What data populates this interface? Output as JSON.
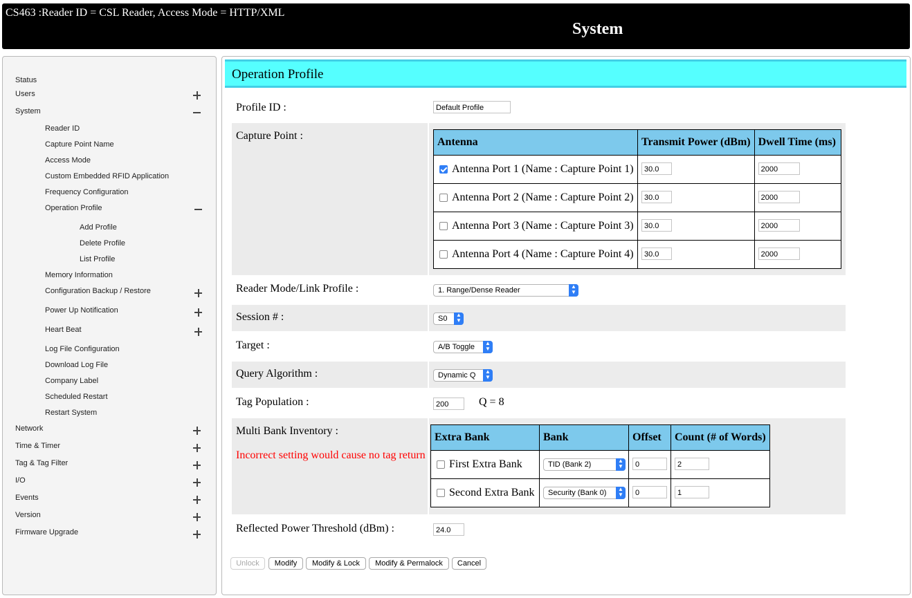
{
  "banner": {
    "reader_info": "CS463 :Reader ID = CSL Reader, Access Mode = HTTP/XML",
    "section_title": "System"
  },
  "sidebar": {
    "status": "Status",
    "users": "Users",
    "system": "System",
    "reader_id": "Reader ID",
    "capture_point_name": "Capture Point Name",
    "access_mode": "Access Mode",
    "custom_app": "Custom Embedded RFID Application",
    "frequency_config": "Frequency Configuration",
    "operation_profile": "Operation Profile",
    "add_profile": "Add Profile",
    "delete_profile": "Delete Profile",
    "list_profile": "List Profile",
    "memory_info": "Memory Information",
    "config_backup": "Configuration Backup / Restore",
    "power_up": "Power Up Notification",
    "heart_beat": "Heart Beat",
    "log_file_config": "Log File Configuration",
    "download_log": "Download Log File",
    "company_label": "Company Label",
    "scheduled_restart": "Scheduled Restart",
    "restart_system": "Restart System",
    "network": "Network",
    "time_timer": "Time & Timer",
    "tag_filter": "Tag & Tag Filter",
    "io": "I/O",
    "events": "Events",
    "version": "Version",
    "firmware_upgrade": "Firmware Upgrade"
  },
  "form": {
    "title": "Operation Profile",
    "profile_id": {
      "label": "Profile ID :",
      "value": "Default Profile"
    },
    "capture_point": {
      "label": "Capture Point :",
      "headers": {
        "antenna": "Antenna",
        "power": "Transmit Power (dBm)",
        "dwell": "Dwell Time (ms)"
      },
      "ports": [
        {
          "name": "Antenna Port 1 (Name : Capture Point 1)",
          "checked": true,
          "power": "30.0",
          "dwell": "2000"
        },
        {
          "name": "Antenna Port 2 (Name : Capture Point 2)",
          "checked": false,
          "power": "30.0",
          "dwell": "2000"
        },
        {
          "name": "Antenna Port 3 (Name : Capture Point 3)",
          "checked": false,
          "power": "30.0",
          "dwell": "2000"
        },
        {
          "name": "Antenna Port 4 (Name : Capture Point 4)",
          "checked": false,
          "power": "30.0",
          "dwell": "2000"
        }
      ]
    },
    "reader_mode": {
      "label": "Reader Mode/Link Profile :",
      "value": "1. Range/Dense Reader"
    },
    "session": {
      "label": "Session # :",
      "value": "S0"
    },
    "target": {
      "label": "Target :",
      "value": "A/B Toggle"
    },
    "query_algorithm": {
      "label": "Query Algorithm :",
      "value": "Dynamic Q"
    },
    "tag_population": {
      "label": "Tag Population :",
      "value": "200",
      "q_text": "Q = 8"
    },
    "multi_bank": {
      "label": "Multi Bank Inventory :",
      "warning": "Incorrect setting would cause no tag return",
      "headers": {
        "extra_bank": "Extra Bank",
        "bank": "Bank",
        "offset": "Offset",
        "count": "Count (# of Words)"
      },
      "rows": [
        {
          "name": "First Extra Bank",
          "checked": false,
          "bank": "TID (Bank 2)",
          "offset": "0",
          "count": "2"
        },
        {
          "name": "Second Extra Bank",
          "checked": false,
          "bank": "Security (Bank 0)",
          "offset": "0",
          "count": "1"
        }
      ]
    },
    "reflected_power": {
      "label": "Reflected Power Threshold (dBm) :",
      "value": "24.0"
    }
  },
  "buttons": {
    "unlock": "Unlock",
    "modify": "Modify",
    "modify_lock": "Modify & Lock",
    "modify_permalock": "Modify & Permalock",
    "cancel": "Cancel"
  },
  "colors": {
    "header_bg": "#55ffff",
    "table_header_bg": "#7dc9ec",
    "warning_text": "#ff0000",
    "select_arrow": "#2f7ef6"
  }
}
